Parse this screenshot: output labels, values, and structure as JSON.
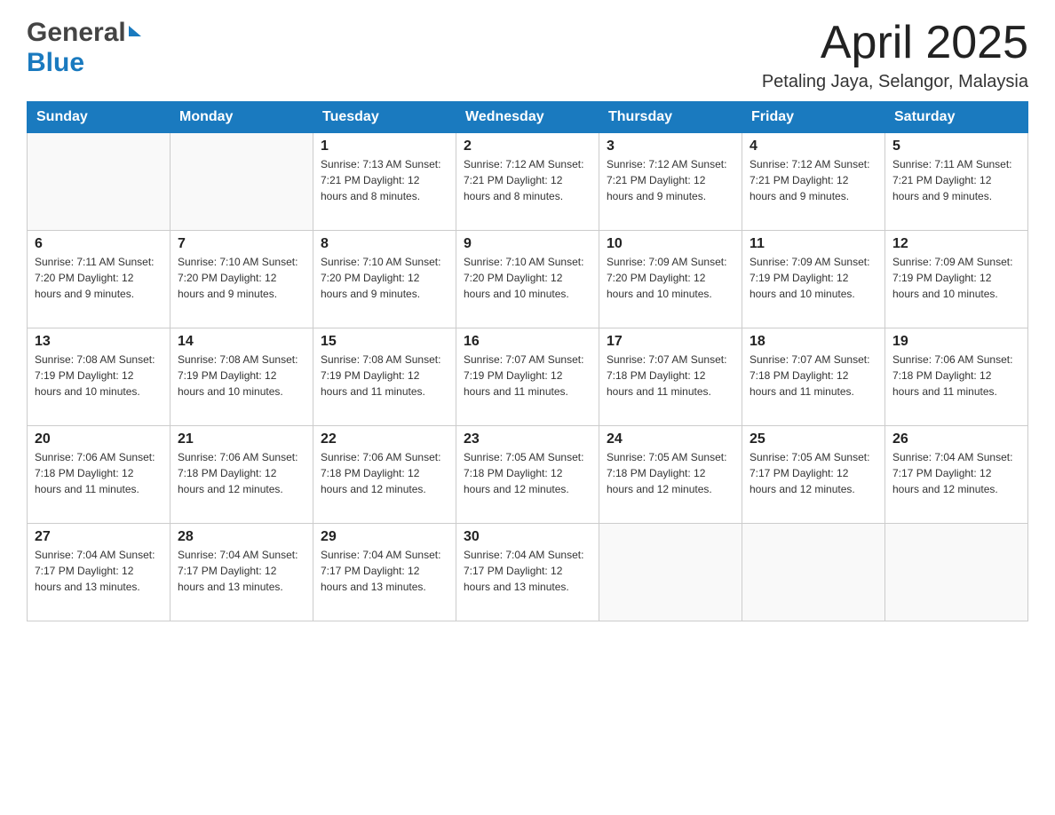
{
  "header": {
    "month_title": "April 2025",
    "location": "Petaling Jaya, Selangor, Malaysia",
    "logo_general": "General",
    "logo_blue": "Blue"
  },
  "columns": [
    "Sunday",
    "Monday",
    "Tuesday",
    "Wednesday",
    "Thursday",
    "Friday",
    "Saturday"
  ],
  "weeks": [
    [
      {
        "day": "",
        "info": ""
      },
      {
        "day": "",
        "info": ""
      },
      {
        "day": "1",
        "info": "Sunrise: 7:13 AM\nSunset: 7:21 PM\nDaylight: 12 hours\nand 8 minutes."
      },
      {
        "day": "2",
        "info": "Sunrise: 7:12 AM\nSunset: 7:21 PM\nDaylight: 12 hours\nand 8 minutes."
      },
      {
        "day": "3",
        "info": "Sunrise: 7:12 AM\nSunset: 7:21 PM\nDaylight: 12 hours\nand 9 minutes."
      },
      {
        "day": "4",
        "info": "Sunrise: 7:12 AM\nSunset: 7:21 PM\nDaylight: 12 hours\nand 9 minutes."
      },
      {
        "day": "5",
        "info": "Sunrise: 7:11 AM\nSunset: 7:21 PM\nDaylight: 12 hours\nand 9 minutes."
      }
    ],
    [
      {
        "day": "6",
        "info": "Sunrise: 7:11 AM\nSunset: 7:20 PM\nDaylight: 12 hours\nand 9 minutes."
      },
      {
        "day": "7",
        "info": "Sunrise: 7:10 AM\nSunset: 7:20 PM\nDaylight: 12 hours\nand 9 minutes."
      },
      {
        "day": "8",
        "info": "Sunrise: 7:10 AM\nSunset: 7:20 PM\nDaylight: 12 hours\nand 9 minutes."
      },
      {
        "day": "9",
        "info": "Sunrise: 7:10 AM\nSunset: 7:20 PM\nDaylight: 12 hours\nand 10 minutes."
      },
      {
        "day": "10",
        "info": "Sunrise: 7:09 AM\nSunset: 7:20 PM\nDaylight: 12 hours\nand 10 minutes."
      },
      {
        "day": "11",
        "info": "Sunrise: 7:09 AM\nSunset: 7:19 PM\nDaylight: 12 hours\nand 10 minutes."
      },
      {
        "day": "12",
        "info": "Sunrise: 7:09 AM\nSunset: 7:19 PM\nDaylight: 12 hours\nand 10 minutes."
      }
    ],
    [
      {
        "day": "13",
        "info": "Sunrise: 7:08 AM\nSunset: 7:19 PM\nDaylight: 12 hours\nand 10 minutes."
      },
      {
        "day": "14",
        "info": "Sunrise: 7:08 AM\nSunset: 7:19 PM\nDaylight: 12 hours\nand 10 minutes."
      },
      {
        "day": "15",
        "info": "Sunrise: 7:08 AM\nSunset: 7:19 PM\nDaylight: 12 hours\nand 11 minutes."
      },
      {
        "day": "16",
        "info": "Sunrise: 7:07 AM\nSunset: 7:19 PM\nDaylight: 12 hours\nand 11 minutes."
      },
      {
        "day": "17",
        "info": "Sunrise: 7:07 AM\nSunset: 7:18 PM\nDaylight: 12 hours\nand 11 minutes."
      },
      {
        "day": "18",
        "info": "Sunrise: 7:07 AM\nSunset: 7:18 PM\nDaylight: 12 hours\nand 11 minutes."
      },
      {
        "day": "19",
        "info": "Sunrise: 7:06 AM\nSunset: 7:18 PM\nDaylight: 12 hours\nand 11 minutes."
      }
    ],
    [
      {
        "day": "20",
        "info": "Sunrise: 7:06 AM\nSunset: 7:18 PM\nDaylight: 12 hours\nand 11 minutes."
      },
      {
        "day": "21",
        "info": "Sunrise: 7:06 AM\nSunset: 7:18 PM\nDaylight: 12 hours\nand 12 minutes."
      },
      {
        "day": "22",
        "info": "Sunrise: 7:06 AM\nSunset: 7:18 PM\nDaylight: 12 hours\nand 12 minutes."
      },
      {
        "day": "23",
        "info": "Sunrise: 7:05 AM\nSunset: 7:18 PM\nDaylight: 12 hours\nand 12 minutes."
      },
      {
        "day": "24",
        "info": "Sunrise: 7:05 AM\nSunset: 7:18 PM\nDaylight: 12 hours\nand 12 minutes."
      },
      {
        "day": "25",
        "info": "Sunrise: 7:05 AM\nSunset: 7:17 PM\nDaylight: 12 hours\nand 12 minutes."
      },
      {
        "day": "26",
        "info": "Sunrise: 7:04 AM\nSunset: 7:17 PM\nDaylight: 12 hours\nand 12 minutes."
      }
    ],
    [
      {
        "day": "27",
        "info": "Sunrise: 7:04 AM\nSunset: 7:17 PM\nDaylight: 12 hours\nand 13 minutes."
      },
      {
        "day": "28",
        "info": "Sunrise: 7:04 AM\nSunset: 7:17 PM\nDaylight: 12 hours\nand 13 minutes."
      },
      {
        "day": "29",
        "info": "Sunrise: 7:04 AM\nSunset: 7:17 PM\nDaylight: 12 hours\nand 13 minutes."
      },
      {
        "day": "30",
        "info": "Sunrise: 7:04 AM\nSunset: 7:17 PM\nDaylight: 12 hours\nand 13 minutes."
      },
      {
        "day": "",
        "info": ""
      },
      {
        "day": "",
        "info": ""
      },
      {
        "day": "",
        "info": ""
      }
    ]
  ]
}
